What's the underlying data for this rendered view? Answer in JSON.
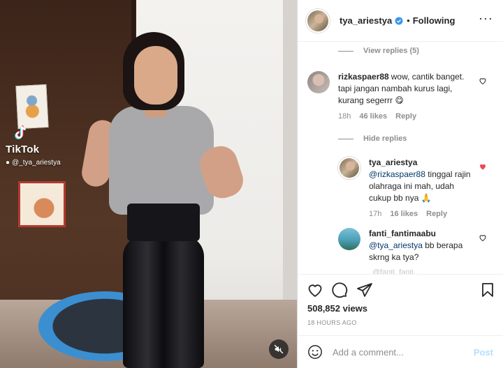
{
  "video": {
    "watermark_brand": "TikTok",
    "watermark_handle": "@_tya_ariestya"
  },
  "header": {
    "username": "tya_ariestya",
    "separator": "•",
    "follow_status": "Following"
  },
  "comments": {
    "view_replies_label": "View replies (5)",
    "hide_replies_label": "Hide replies",
    "items": [
      {
        "username": "rizkaspaer88",
        "text": "wow, cantik banget. tapi jangan nambah kurus lagi, kurang segerrr 😋",
        "time": "18h",
        "likes": "46 likes",
        "reply_label": "Reply",
        "liked": false
      },
      {
        "username": "tya_ariestya",
        "mention": "@rizkaspaer88",
        "text": " tinggal rajin olahraga ini mah, udah cukup bb nya 🙏",
        "time": "17h",
        "likes": "16 likes",
        "reply_label": "Reply",
        "liked": true
      },
      {
        "username": "fanti_fantimaabu",
        "mention": "@tya_ariestya",
        "text": " bb berapa skrng ka tya?",
        "liked": false
      }
    ],
    "faded_text": "@fanti_fanti..."
  },
  "actions": {
    "views": "508,852 views",
    "time_ago": "18 HOURS AGO"
  },
  "add_comment": {
    "placeholder": "Add a comment...",
    "post_label": "Post"
  },
  "colors": {
    "verified": "#3897f0",
    "liked_heart": "#ed4956",
    "link": "#00376b",
    "post_button": "#b2dffc"
  }
}
